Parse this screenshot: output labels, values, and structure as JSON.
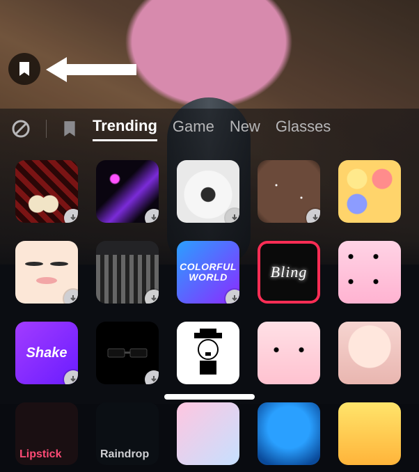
{
  "annotation": {
    "arrow_target": "bookmark-button"
  },
  "topbar": {
    "none_icon": "none-icon",
    "bookmark_icon": "bookmark-icon"
  },
  "tabs": [
    {
      "id": "trending",
      "label": "Trending",
      "active": true
    },
    {
      "id": "game",
      "label": "Game",
      "active": false
    },
    {
      "id": "new",
      "label": "New",
      "active": false
    },
    {
      "id": "glasses",
      "label": "Glasses",
      "active": false
    }
  ],
  "selected_effect": "bling",
  "effects": {
    "row1": [
      {
        "id": "beret",
        "download": true
      },
      {
        "id": "laser",
        "download": true
      },
      {
        "id": "flower",
        "download": true
      },
      {
        "id": "galaxy",
        "download": true
      },
      {
        "id": "sunglasses-quad",
        "download": false
      }
    ],
    "row2": [
      {
        "id": "noface",
        "download": true
      },
      {
        "id": "city",
        "download": true
      },
      {
        "id": "colorful-world",
        "download": true,
        "label_line1": "COLORFUL",
        "label_line2": "WORLD"
      },
      {
        "id": "bling",
        "download": false,
        "label": "Bling",
        "selected": true
      },
      {
        "id": "pink-grid",
        "download": false
      }
    ],
    "row3": [
      {
        "id": "shake",
        "download": true,
        "label": "Shake"
      },
      {
        "id": "sunglasses-black",
        "download": true
      },
      {
        "id": "chaplin",
        "download": false
      },
      {
        "id": "toy",
        "download": false
      },
      {
        "id": "portrait",
        "download": false
      }
    ],
    "row4": [
      {
        "id": "lipstick",
        "download": false,
        "label": "Lipstick"
      },
      {
        "id": "raindrop",
        "download": false,
        "label": "Raindrop"
      },
      {
        "id": "pastel",
        "download": false
      },
      {
        "id": "blue",
        "download": false
      },
      {
        "id": "yellow",
        "download": false
      }
    ]
  }
}
